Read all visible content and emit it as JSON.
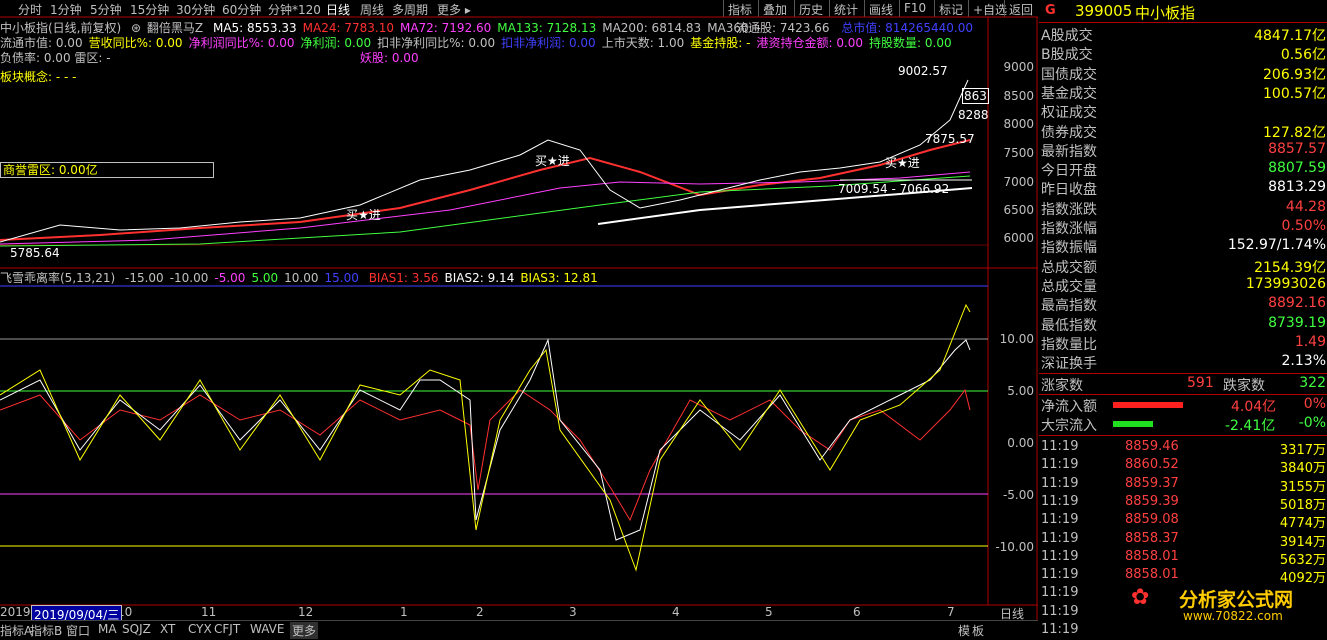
{
  "toolbar": {
    "periods": [
      "分时",
      "1分钟",
      "5分钟",
      "15分钟",
      "30分钟",
      "60分钟",
      "分钟*120",
      "日线",
      "周线",
      "多周期",
      "更多 ▸"
    ],
    "active_period": "日线",
    "right_buttons": [
      "指标",
      "叠加",
      "历史",
      "统计",
      "画线",
      "F10",
      "标记",
      "+自选",
      "返回"
    ]
  },
  "main_chart": {
    "title": "中小板指(日线,前复权)",
    "indicator": "翻倍黑马Z",
    "ma": [
      {
        "label": "MA5: 8553.33",
        "color": "#ffffff"
      },
      {
        "label": "MA24: 7783.10",
        "color": "#ff3030"
      },
      {
        "label": "MA72: 7192.60",
        "color": "#ff40ff"
      },
      {
        "label": "MA133: 7128.13",
        "color": "#40ff40"
      },
      {
        "label": "MA200: 6814.83",
        "color": "#c0c0c0"
      },
      {
        "label": "MA360: -",
        "color": "#c0c0c0"
      }
    ],
    "float_label": "流通股: 7423.66",
    "total_label": "总市值: 814265440.00",
    "info_line": [
      {
        "text": "流通市值: 0.00",
        "color": "#c0c0c0"
      },
      {
        "text": "营收同比%: 0.00",
        "color": "#ffff00"
      },
      {
        "text": "净利润同比%: 0.00",
        "color": "#ff40ff"
      },
      {
        "text": "净利润: 0.00",
        "color": "#40ff40"
      },
      {
        "text": "扣非净利同比%: 0.00",
        "color": "#c0c0c0"
      },
      {
        "text": "扣非净利润: 0.00",
        "color": "#4040ff"
      },
      {
        "text": "上市天数: 1.00",
        "color": "#c0c0c0"
      },
      {
        "text": "基金持股: -",
        "color": "#ffff00"
      },
      {
        "text": "港资持仓金额: 0.00",
        "color": "#ff40ff"
      },
      {
        "text": "持股数量: 0.00",
        "color": "#40ff40"
      }
    ],
    "debt_line": "负债率: 0.00  雷区: -",
    "demon_label": "妖股: 0.00",
    "concept_label": "板块概念:  - - -",
    "goodwill_label": "商誉雷区:       0.00亿",
    "price_axis": [
      "9000",
      "8500",
      "8000",
      "7500",
      "7000",
      "6500",
      "6000"
    ],
    "annotations": {
      "high": "9002.57",
      "p7875": "7875.57",
      "p8288": "8288",
      "p863": "863",
      "support": "7009.54 - 7066.92",
      "low": "5785.64",
      "buy1": "买★进",
      "buy2": "买★进",
      "buy3": "买★进"
    }
  },
  "sub_chart": {
    "title": "飞雪乖离率(5,13,21)",
    "levels": [
      {
        "text": "-15.00",
        "color": "#c0c0c0"
      },
      {
        "text": "-10.00",
        "color": "#c0c0c0"
      },
      {
        "text": "-5.00",
        "color": "#ff40ff"
      },
      {
        "text": "5.00",
        "color": "#40ff40"
      },
      {
        "text": "10.00",
        "color": "#c0c0c0"
      },
      {
        "text": "15.00",
        "color": "#4040ff"
      }
    ],
    "bias": [
      {
        "text": "BIAS1: 3.56",
        "color": "#ff3030"
      },
      {
        "text": "BIAS2: 9.14",
        "color": "#ffffff"
      },
      {
        "text": "BIAS3: 12.81",
        "color": "#ffff00"
      }
    ],
    "axis": [
      "10.00",
      "5.00",
      "0.00",
      "-5.00",
      "-10.00"
    ]
  },
  "date_axis": {
    "labels": [
      "2019",
      "10",
      "11",
      "12",
      "1",
      "2",
      "3",
      "4",
      "5",
      "6",
      "7"
    ],
    "cursor_date": "2019/09/04/三",
    "period": "日线"
  },
  "bottom_tabs": [
    "指标B",
    "窗口",
    "MA",
    "SQJZ",
    "XT",
    "CYX",
    "CFJT",
    "WAVE",
    "更多"
  ],
  "bottom_first": "指标A",
  "bottom_right": [
    "模",
    "板"
  ],
  "quote": {
    "code": "399005",
    "name": "中小板指",
    "flag": "G",
    "rows": [
      {
        "label": "A股成交",
        "value": "4847.17亿",
        "color": "#ffff00"
      },
      {
        "label": "B股成交",
        "value": "0.56亿",
        "color": "#ffff00"
      },
      {
        "label": "国债成交",
        "value": "206.93亿",
        "color": "#ffff00"
      },
      {
        "label": "基金成交",
        "value": "100.57亿",
        "color": "#ffff00"
      },
      {
        "label": "权证成交",
        "value": "",
        "color": "#ffff00"
      },
      {
        "label": "债券成交",
        "value": "127.82亿",
        "color": "#ffff00"
      },
      {
        "label": "最新指数",
        "value": "8857.57",
        "color": "#ff4040"
      },
      {
        "label": "今日开盘",
        "value": "8807.59",
        "color": "#40ff40"
      },
      {
        "label": "昨日收盘",
        "value": "8813.29",
        "color": "#ffffff"
      },
      {
        "label": "指数涨跌",
        "value": "44.28",
        "color": "#ff4040"
      },
      {
        "label": "指数涨幅",
        "value": "0.50%",
        "color": "#ff4040"
      },
      {
        "label": "指数振幅",
        "value": "152.97/1.74%",
        "color": "#ffffff"
      },
      {
        "label": "总成交额",
        "value": "2154.39亿",
        "color": "#ffff00"
      },
      {
        "label": "总成交量",
        "value": "173993026",
        "color": "#ffff00"
      },
      {
        "label": "最高指数",
        "value": "8892.16",
        "color": "#ff4040"
      },
      {
        "label": "最低指数",
        "value": "8739.19",
        "color": "#40ff40"
      },
      {
        "label": "指数量比",
        "value": "1.49",
        "color": "#ff4040"
      },
      {
        "label": "深证换手",
        "value": "2.13%",
        "color": "#ffffff"
      }
    ],
    "up_label": "涨家数",
    "up_value": "591",
    "down_label": "跌家数",
    "down_value": "322",
    "netflow_label": "净流入额",
    "netflow_value": "4.04亿",
    "netflow_pct": "0%",
    "block_label": "大宗流入",
    "block_value": "-2.41亿",
    "block_pct": "-0%",
    "ticks": [
      {
        "time": "11:19",
        "price": "8859.46",
        "vol": "3317万"
      },
      {
        "time": "11:19",
        "price": "8860.52",
        "vol": "3840万"
      },
      {
        "time": "11:19",
        "price": "8859.37",
        "vol": "3155万"
      },
      {
        "time": "11:19",
        "price": "8859.39",
        "vol": "5018万"
      },
      {
        "time": "11:19",
        "price": "8859.08",
        "vol": "4774万"
      },
      {
        "time": "11:19",
        "price": "8858.37",
        "vol": "3914万"
      },
      {
        "time": "11:19",
        "price": "8858.01",
        "vol": "5632万"
      },
      {
        "time": "11:19",
        "price": "8858.01",
        "vol": "4092万"
      },
      {
        "time": "11:19",
        "price": "",
        "vol": ""
      },
      {
        "time": "11:19",
        "price": "",
        "vol": ""
      },
      {
        "time": "11:19",
        "price": "",
        "vol": ""
      }
    ],
    "watermark": "分析家公式网",
    "watermark_url": "www.70822.com"
  },
  "colors": {
    "red": "#ff3030",
    "white": "#ffffff",
    "magenta": "#ff40ff",
    "green": "#40ff40",
    "yellow": "#ffff00",
    "frame": "#b00000"
  }
}
